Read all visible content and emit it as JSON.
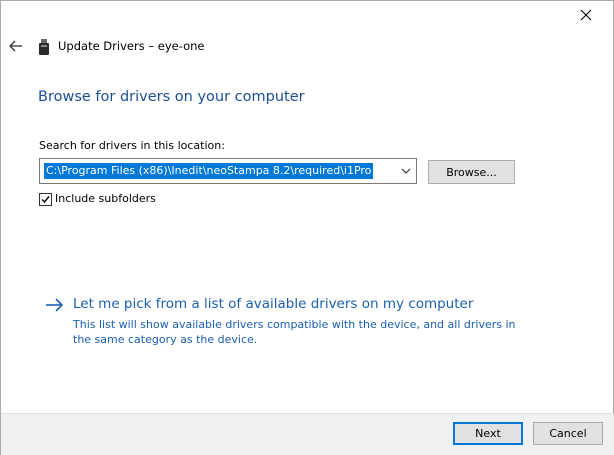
{
  "window": {
    "title": "Update Drivers – eye-one",
    "close_icon": "close-icon",
    "back_icon": "back-arrow-icon",
    "device_icon": "usb-device-icon"
  },
  "main": {
    "heading": "Browse for drivers on your computer",
    "search_label": "Search for drivers in this location:",
    "path_value": "C:\\Program Files (x86)\\Inedit\\neoStampa 8.2\\required\\i1Pro",
    "browse_label": "Browse...",
    "include_subfolders_label": "Include subfolders",
    "include_subfolders_checked": true
  },
  "pick": {
    "title": "Let me pick from a list of available drivers on my computer",
    "description": "This list will show available drivers compatible with the device, and all drivers in the same category as the device.",
    "icon": "arrow-right-icon"
  },
  "footer": {
    "next_label": "Next",
    "cancel_label": "Cancel"
  },
  "colors": {
    "heading": "#1c4e94",
    "link": "#1b5fb0",
    "selection": "#0078d7"
  }
}
